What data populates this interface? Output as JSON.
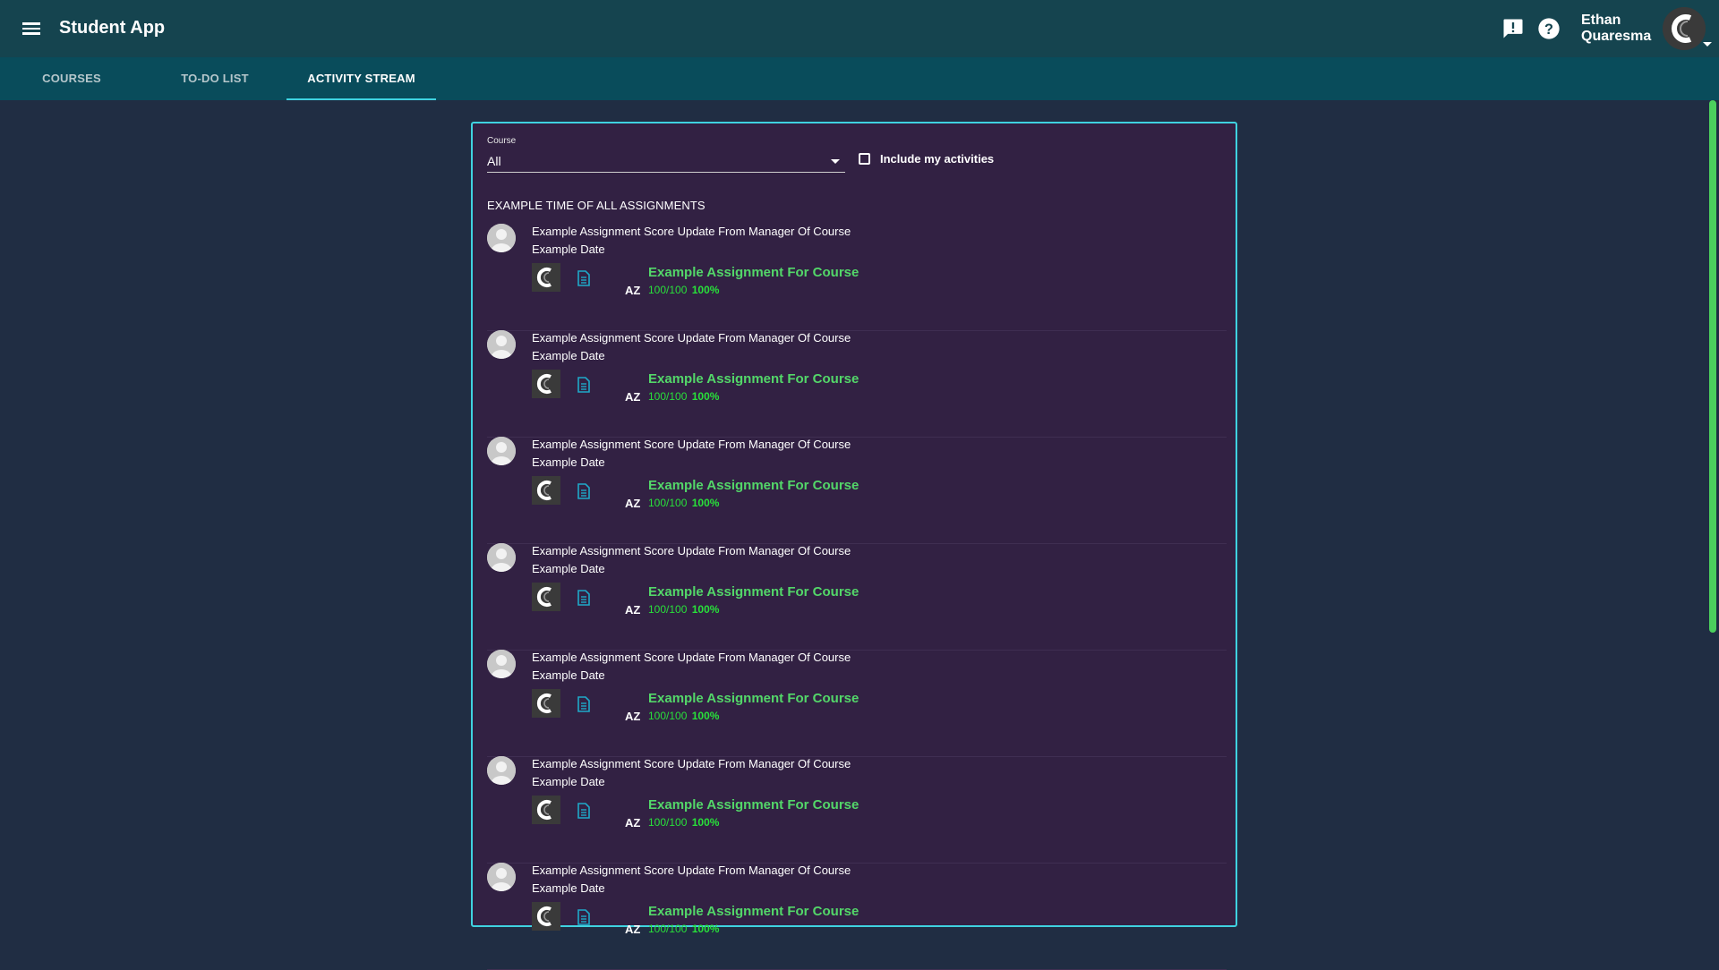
{
  "header": {
    "app_title": "Student App",
    "user_name_first": "Ethan",
    "user_name_last": "Quaresma",
    "icons": [
      "menu-icon",
      "feedback-icon",
      "help-icon",
      "user-avatar"
    ]
  },
  "tabs": [
    {
      "label": "COURSES",
      "active": false
    },
    {
      "label": "TO-DO LIST",
      "active": false
    },
    {
      "label": "ACTIVITY STREAM",
      "active": true
    }
  ],
  "filter": {
    "course_label": "Course",
    "course_value": "All",
    "include_label": "Include my activities",
    "include_checked": false
  },
  "stream": {
    "section_title": "EXAMPLE TIME OF ALL ASSIGNMENTS",
    "items": [
      {
        "title": "Example Assignment Score Update From Manager Of Course",
        "date": "Example Date",
        "course_code": "AZ",
        "assignment": "Example Assignment For Course",
        "score": "100/100",
        "percent": "100%"
      },
      {
        "title": "Example Assignment Score Update From Manager Of Course",
        "date": "Example Date",
        "course_code": "AZ",
        "assignment": "Example Assignment For Course",
        "score": "100/100",
        "percent": "100%"
      },
      {
        "title": "Example Assignment Score Update From Manager Of Course",
        "date": "Example Date",
        "course_code": "AZ",
        "assignment": "Example Assignment For Course",
        "score": "100/100",
        "percent": "100%"
      },
      {
        "title": "Example Assignment Score Update From Manager Of Course",
        "date": "Example Date",
        "course_code": "AZ",
        "assignment": "Example Assignment For Course",
        "score": "100/100",
        "percent": "100%"
      },
      {
        "title": "Example Assignment Score Update From Manager Of Course",
        "date": "Example Date",
        "course_code": "AZ",
        "assignment": "Example Assignment For Course",
        "score": "100/100",
        "percent": "100%"
      },
      {
        "title": "Example Assignment Score Update From Manager Of Course",
        "date": "Example Date",
        "course_code": "AZ",
        "assignment": "Example Assignment For Course",
        "score": "100/100",
        "percent": "100%"
      },
      {
        "title": "Example Assignment Score Update From Manager Of Course",
        "date": "Example Date",
        "course_code": "AZ",
        "assignment": "Example Assignment For Course",
        "score": "100/100",
        "percent": "100%"
      }
    ]
  },
  "colors": {
    "page_bg": "#202d43",
    "header_bg": "#15444f",
    "tabs_bg": "#094c5b",
    "panel_bg": "#322143",
    "accent": "#3fd2e0",
    "assignment_green": "#53d769",
    "score_green": "#28e03a",
    "scrollbar": "#4ccf5d"
  }
}
